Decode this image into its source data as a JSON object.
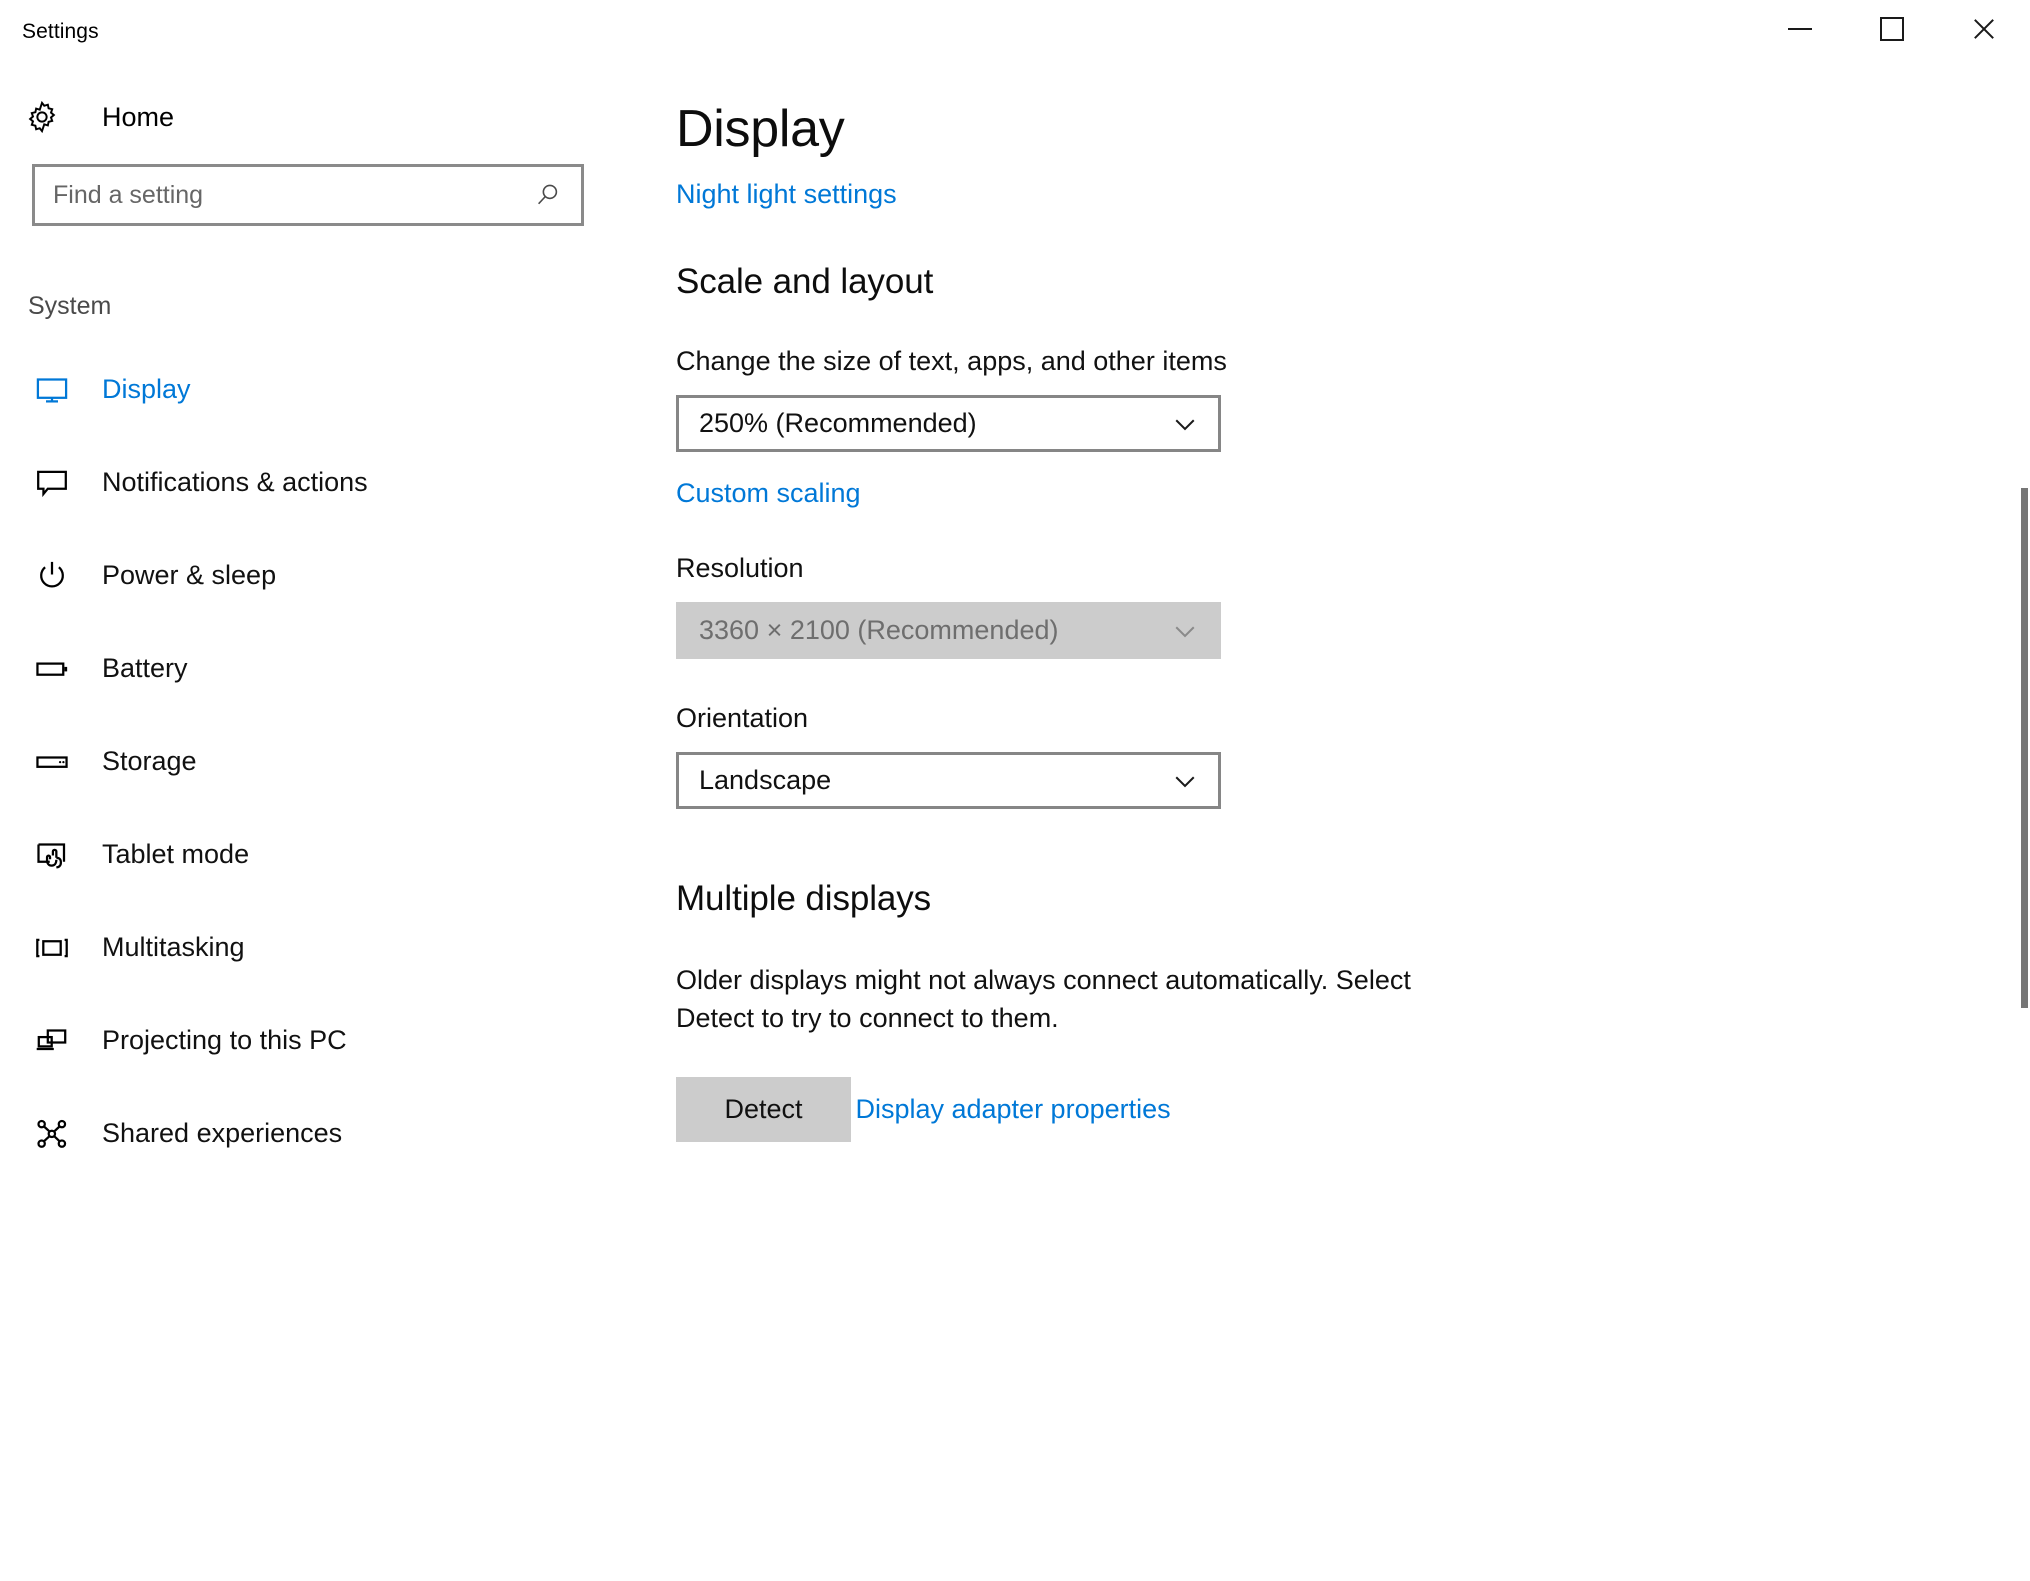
{
  "window": {
    "title": "Settings",
    "controls": {
      "minimize_name": "minimize-button",
      "maximize_name": "maximize-button",
      "close_name": "close-button"
    }
  },
  "sidebar": {
    "home_label": "Home",
    "search": {
      "placeholder": "Find a setting",
      "value": ""
    },
    "section_label": "System",
    "items": [
      {
        "label": "Display",
        "icon": "monitor-icon",
        "active": true
      },
      {
        "label": "Notifications & actions",
        "icon": "speech-bubble-icon",
        "active": false
      },
      {
        "label": "Power & sleep",
        "icon": "power-icon",
        "active": false
      },
      {
        "label": "Battery",
        "icon": "battery-icon",
        "active": false
      },
      {
        "label": "Storage",
        "icon": "drive-icon",
        "active": false
      },
      {
        "label": "Tablet mode",
        "icon": "tablet-touch-icon",
        "active": false
      },
      {
        "label": "Multitasking",
        "icon": "multitasking-icon",
        "active": false
      },
      {
        "label": "Projecting to this PC",
        "icon": "projecting-icon",
        "active": false
      },
      {
        "label": "Shared experiences",
        "icon": "share-nodes-icon",
        "active": false
      }
    ]
  },
  "main": {
    "page_title": "Display",
    "night_light_link": "Night light settings",
    "scale_and_layout": {
      "heading": "Scale and layout",
      "scale_label": "Change the size of text, apps, and other items",
      "scale_value": "250% (Recommended)",
      "custom_scaling_link": "Custom scaling",
      "resolution_label": "Resolution",
      "resolution_value": "3360 × 2100 (Recommended)",
      "orientation_label": "Orientation",
      "orientation_value": "Landscape"
    },
    "multiple_displays": {
      "heading": "Multiple displays",
      "description": "Older displays might not always connect automatically. Select Detect to try to connect to them.",
      "detect_button": "Detect",
      "adapter_link": "Display adapter properties"
    }
  },
  "colors": {
    "accent": "#0078d7",
    "text": "#111111",
    "muted": "#6e6e6e",
    "border": "#868686",
    "disabled_bg": "#cccccc"
  }
}
